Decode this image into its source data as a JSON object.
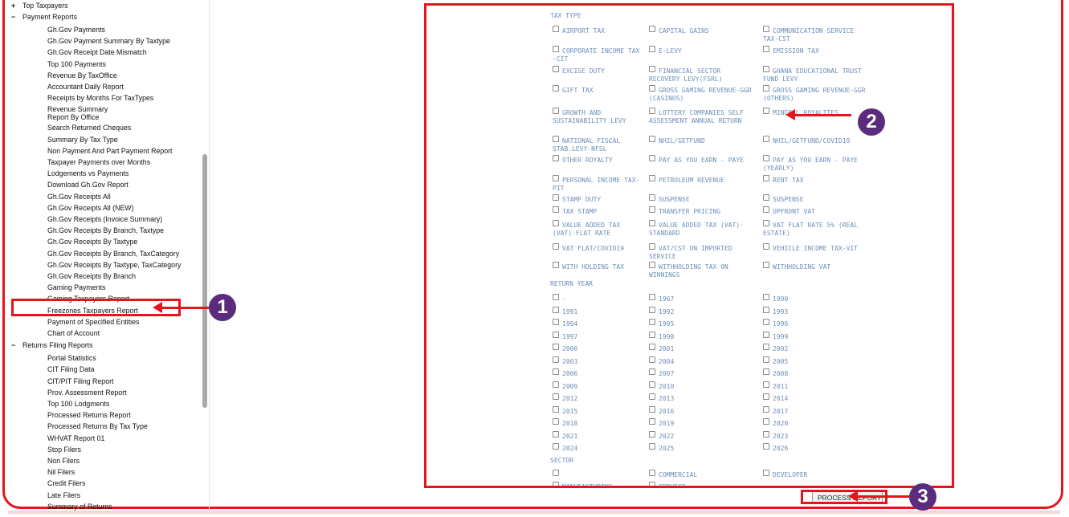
{
  "sidebar": {
    "top_taxpayers": {
      "toggle": "+",
      "label": "Top Taxpayers"
    },
    "payment_reports": {
      "toggle": "−",
      "label": "Payment Reports",
      "items": [
        "Gh.Gov Payments",
        "Gh.Gov Payment Summary By Taxtype",
        "Gh.Gov Receipt Date Mismatch",
        "Top 100 Payments",
        "Revenue By TaxOffice",
        "Accountant Daily Report",
        "Receipts by Months For TaxTypes",
        "Revenue Summary\nReport By Office",
        "Search Returned Cheques",
        "Summary By Tax Type",
        "Non Payment And Part Payment Report",
        "Taxpayer Payments over Months",
        "Lodgements vs Payments",
        "Download Gh.Gov Report",
        "Gh.Gov Receipts All",
        "Gh.Gov Receipts All (NEW)",
        "Gh.Gov Receipts (Invoice Summary)",
        "Gh.Gov Receipts By Branch, Taxtype",
        "Gh.Gov Receipts By Taxtype",
        "Gh.Gov Receipts By Branch, TaxCategory",
        "Gh.Gov Receipts By Taxtype, TaxCategory",
        "Gh.Gov Receipts By Branch",
        "Gaming Payments",
        "Gaming Taxpayers Report",
        "Freezones Taxpayers Report",
        "Payment of Specified Entities",
        "Chart of Account"
      ]
    },
    "returns_filing_reports": {
      "toggle": "−",
      "label": "Returns Filing Reports",
      "items": [
        "Portal Statistics",
        "CIT Filing Data",
        "CIT/PIT Filing Report",
        "Prov. Assessment Report",
        "Top 100 Lodgments",
        "Processed Returns Report",
        "Processed Returns By Tax Type",
        "WHVAT Report 01",
        "Stop Filers",
        "Non Filers",
        "Nil Filers",
        "Credit Filers",
        "Late Filers",
        "Summary of Returns"
      ]
    }
  },
  "form": {
    "tax_type_label": "TAX TYPE",
    "tax_types": [
      "AIRPORT TAX",
      "CAPITAL GAINS",
      "COMMUNICATION SERVICE TAX-CST",
      "CORPORATE INCOME TAX -CIT",
      "E-LEVY",
      "EMISSION TAX",
      "EXCISE DUTY",
      "FINANCIAL SECTOR RECOVERY LEVY(FSRL)",
      "GHANA EDUCATIONAL TRUST FUND LEVY",
      "GIFT TAX",
      "GROSS GAMING REVENUE-GGR (CASINOS)",
      "GROSS GAMING REVENUE-GGR (OTHERS)",
      "GROWTH AND SUSTAINABILITY LEVY",
      "LOTTERY COMPANIES SELF ASSESSMENT ANNUAL RETURN",
      "MINERAL ROYALTIES",
      "NATIONAL FISCAL STAB.LEVY-NFSL",
      "NHIL/GETFUND",
      "NHIL/GETFUND/COVID19",
      "OTHER ROYALTY",
      "PAY AS YOU EARN - PAYE",
      "PAY AS YOU EARN - PAYE (YEARLY)",
      "PERSONAL INCOME TAX-PIT",
      "PETROLEUM REVENUE",
      "RENT TAX",
      "STAMP DUTY",
      "SUSPENSE",
      "SUSPENSE",
      "TAX STAMP",
      "TRANSFER PRICING",
      "UPFRONT VAT",
      "VALUE ADDED TAX (VAT)-FLAT RATE",
      "VALUE ADDED TAX (VAT)-STANDARD",
      "VAT FLAT RATE 5% (REAL ESTATE)",
      "VAT FLAT/COVID19",
      "VAT/CST ON IMPORTED SERVICE",
      "VEHICLE INCOME TAX-VIT",
      "WITH HOLDING TAX",
      "WITHHOLDING TAX ON WINNINGS",
      "WITHHOLDING VAT"
    ],
    "return_year_label": "RETURN YEAR",
    "years": [
      "-",
      "1967",
      "1990",
      "1991",
      "1992",
      "1993",
      "1994",
      "1995",
      "1996",
      "1997",
      "1998",
      "1999",
      "2000",
      "2001",
      "2002",
      "2003",
      "2004",
      "2005",
      "2006",
      "2007",
      "2008",
      "2009",
      "2010",
      "2011",
      "2012",
      "2013",
      "2014",
      "2015",
      "2016",
      "2017",
      "2018",
      "2019",
      "2020",
      "2021",
      "2022",
      "2023",
      "2024",
      "2025",
      "2026"
    ],
    "sector_label": "SECTOR",
    "sectors": [
      "",
      "COMMERCIAL",
      "DEVELOPER",
      "MANUFACTURING",
      "SERVICE"
    ]
  },
  "process_button": "PROCESS REPORT",
  "callouts": [
    "1",
    "2",
    "3"
  ]
}
